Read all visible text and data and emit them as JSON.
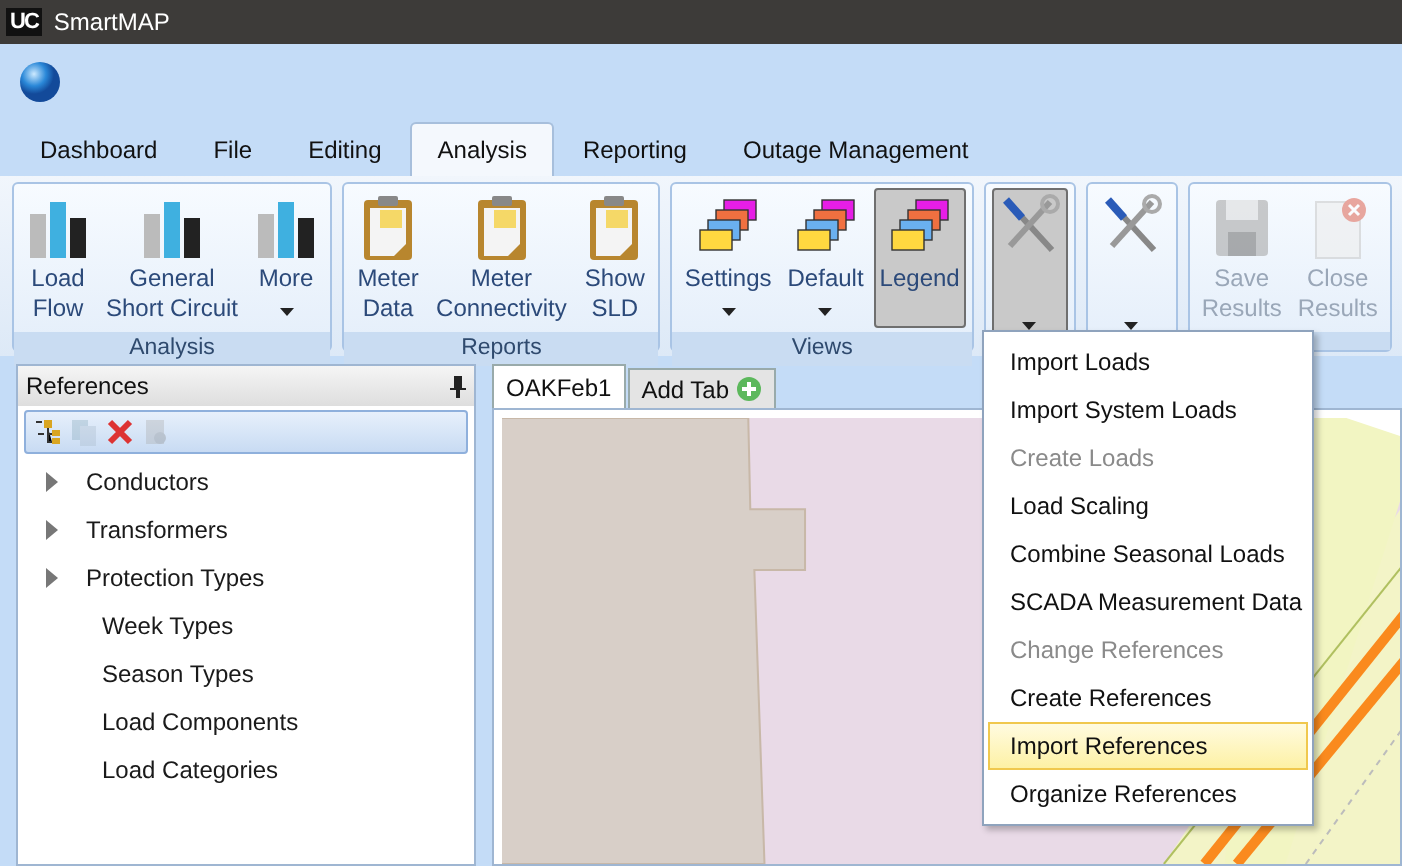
{
  "window": {
    "logo": "UC",
    "title": "SmartMAP"
  },
  "tabs": [
    {
      "label": "Dashboard",
      "selected": false
    },
    {
      "label": "File",
      "selected": false
    },
    {
      "label": "Editing",
      "selected": false
    },
    {
      "label": "Analysis",
      "selected": true
    },
    {
      "label": "Reporting",
      "selected": false
    },
    {
      "label": "Outage Management",
      "selected": false
    }
  ],
  "ribbon": {
    "groups": [
      {
        "label": "Analysis",
        "buttons": [
          {
            "kind": "chart",
            "lines": [
              "Load",
              "Flow"
            ],
            "dropdown": false,
            "disabled": false,
            "pressed": false
          },
          {
            "kind": "chart",
            "lines": [
              "General",
              "Short Circuit"
            ],
            "dropdown": false,
            "disabled": false,
            "pressed": false
          },
          {
            "kind": "chart",
            "lines": [
              "More"
            ],
            "dropdown": true,
            "disabled": false,
            "pressed": false
          }
        ]
      },
      {
        "label": "Reports",
        "buttons": [
          {
            "kind": "clipboard",
            "lines": [
              "Meter",
              "Data"
            ],
            "dropdown": false,
            "disabled": false,
            "pressed": false
          },
          {
            "kind": "clipboard",
            "lines": [
              "Meter",
              "Connectivity"
            ],
            "dropdown": false,
            "disabled": false,
            "pressed": false
          },
          {
            "kind": "clipboard",
            "lines": [
              "Show",
              "SLD"
            ],
            "dropdown": false,
            "disabled": false,
            "pressed": false
          }
        ]
      },
      {
        "label": "Views",
        "buttons": [
          {
            "kind": "layers",
            "lines": [
              "Settings"
            ],
            "dropdown": true,
            "disabled": false,
            "pressed": false
          },
          {
            "kind": "layers",
            "lines": [
              "Default"
            ],
            "dropdown": true,
            "disabled": false,
            "pressed": false
          },
          {
            "kind": "layers",
            "lines": [
              "Legend"
            ],
            "dropdown": false,
            "disabled": false,
            "pressed": true
          }
        ]
      },
      {
        "buttons": [
          {
            "kind": "tools",
            "dropdown": true,
            "disabled": false,
            "pressed": true
          }
        ]
      },
      {
        "buttons": [
          {
            "kind": "tools",
            "dropdown": true,
            "disabled": false,
            "pressed": false
          }
        ]
      },
      {
        "buttons": [
          {
            "kind": "save",
            "lines": [
              "Save",
              "Results"
            ],
            "dropdown": false,
            "disabled": true,
            "pressed": false
          },
          {
            "kind": "close",
            "lines": [
              "Close",
              "Results"
            ],
            "dropdown": false,
            "disabled": true,
            "pressed": false
          }
        ]
      }
    ]
  },
  "references_panel": {
    "title": "References",
    "toolbar": [
      {
        "kind": "tree",
        "disabled": false
      },
      {
        "kind": "copy",
        "disabled": true
      },
      {
        "kind": "delete",
        "disabled": false
      },
      {
        "kind": "settings",
        "disabled": true
      }
    ],
    "items": [
      {
        "label": "Conductors",
        "kind": "branch",
        "expanded": false
      },
      {
        "label": "Transformers",
        "kind": "branch",
        "expanded": false
      },
      {
        "label": "Protection Types",
        "kind": "branch",
        "expanded": false
      },
      {
        "label": "Week Types",
        "kind": "leaf"
      },
      {
        "label": "Season Types",
        "kind": "leaf"
      },
      {
        "label": "Load Components",
        "kind": "leaf"
      },
      {
        "label": "Load Categories",
        "kind": "leaf"
      }
    ]
  },
  "map_tabs": [
    {
      "label": "OAKFeb1",
      "kind": "tab",
      "selected": true
    },
    {
      "label": "Add Tab",
      "kind": "add",
      "selected": false
    }
  ],
  "menu": {
    "items": [
      {
        "label": "Import Loads",
        "disabled": false,
        "selected": false
      },
      {
        "label": "Import System Loads",
        "disabled": false,
        "selected": false
      },
      {
        "label": "Create Loads",
        "disabled": true,
        "selected": false
      },
      {
        "label": "Load Scaling",
        "disabled": false,
        "selected": false
      },
      {
        "label": "Combine Seasonal Loads",
        "disabled": false,
        "selected": false
      },
      {
        "label": "SCADA Measurement Data",
        "disabled": false,
        "selected": false
      },
      {
        "label": "Change References",
        "disabled": true,
        "selected": false
      },
      {
        "label": "Create References",
        "disabled": false,
        "selected": false
      },
      {
        "label": "Import References",
        "disabled": false,
        "selected": true
      },
      {
        "label": "Organize References",
        "disabled": false,
        "selected": false
      }
    ]
  }
}
